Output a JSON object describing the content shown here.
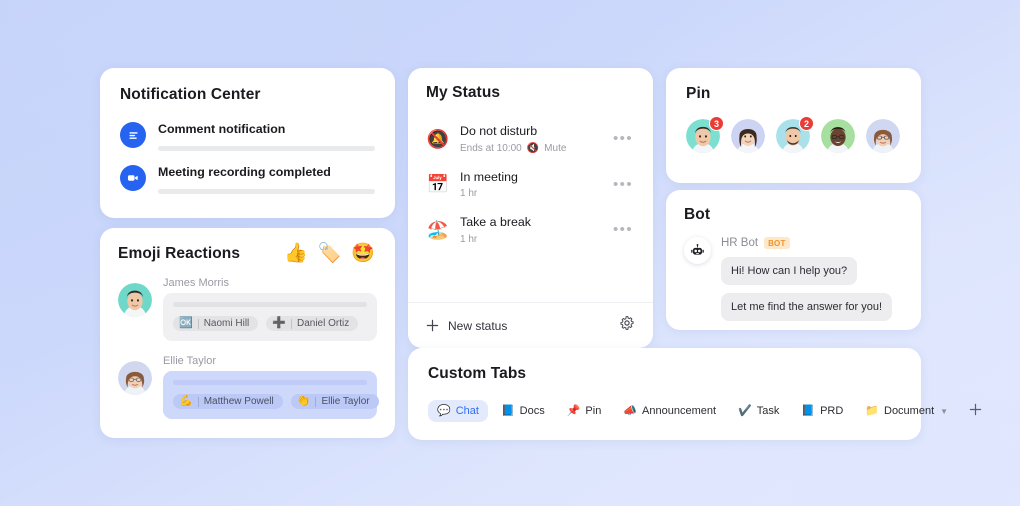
{
  "notification_center": {
    "title": "Notification Center",
    "items": [
      {
        "title": "Comment notification",
        "icon": "comment-icon"
      },
      {
        "title": "Meeting recording completed",
        "icon": "video-camera-icon"
      }
    ]
  },
  "emoji_reactions": {
    "title": "Emoji Reactions",
    "emojis": [
      "👍",
      "🏷️",
      "🤩"
    ],
    "emoji_names": [
      "thumbs-up-emoji",
      "done-badge-emoji",
      "star-struck-emoji"
    ],
    "threads": [
      {
        "name": "James Morris",
        "style": "grey",
        "chips": [
          {
            "emoji": "🆗",
            "label": "Naomi Hill"
          },
          {
            "emoji": "➕",
            "label": "Daniel Ortiz"
          }
        ]
      },
      {
        "name": "Ellie Taylor",
        "style": "blue",
        "chips": [
          {
            "emoji": "💪",
            "label": "Matthew Powell"
          },
          {
            "emoji": "👏",
            "label": "Ellie Taylor"
          }
        ]
      }
    ]
  },
  "my_status": {
    "title": "My Status",
    "items": [
      {
        "emoji": "🔕",
        "name": "Do not disturb",
        "sub": "Ends at 10:00",
        "sub_icon": "🔇",
        "sub_extra": "Mute",
        "menu": "•••"
      },
      {
        "emoji": "📅",
        "name": "In meeting",
        "sub": "1 hr",
        "sub_icon": "",
        "sub_extra": "",
        "menu": "•••"
      },
      {
        "emoji": "🏖️",
        "name": "Take a break",
        "sub": "1 hr",
        "sub_icon": "",
        "sub_extra": "",
        "menu": "•••"
      }
    ],
    "new_status_label": "New status",
    "new_status_icon": "plus-icon",
    "settings_icon": "gear-icon"
  },
  "pin": {
    "title": "Pin",
    "avatars": [
      {
        "name": "avatar-1",
        "badge": "3",
        "bg": "#7ddfd0",
        "skin": "#f0c8a8",
        "hair": "#3a2b22"
      },
      {
        "name": "avatar-2",
        "badge": "",
        "bg": "#cdd3f3",
        "skin": "#f3d3ba",
        "hair": "#3b2a20"
      },
      {
        "name": "avatar-3",
        "badge": "2",
        "bg": "#a9e1ea",
        "skin": "#f0c8a8",
        "hair": "#4a382c"
      },
      {
        "name": "avatar-4",
        "badge": "",
        "bg": "#a6dfa0",
        "skin": "#6b4430",
        "hair": "#241812"
      },
      {
        "name": "avatar-5",
        "badge": "",
        "bg": "#cfd8f0",
        "skin": "#f2cfb4",
        "hair": "#8a5a3a"
      }
    ]
  },
  "bot": {
    "title": "Bot",
    "avatar_icon": "robot-icon",
    "avatar_glyph": "🤖",
    "name": "HR Bot",
    "tag": "BOT",
    "messages": [
      "Hi! How can I help you?",
      "Let me find the answer for you!"
    ]
  },
  "custom_tabs": {
    "title": "Custom Tabs",
    "tabs": [
      {
        "label": "Chat",
        "emoji": "💬",
        "icon": "chat-icon",
        "active": true,
        "caret": false
      },
      {
        "label": "Docs",
        "emoji": "📘",
        "icon": "docs-icon",
        "active": false,
        "caret": false
      },
      {
        "label": "Pin",
        "emoji": "📌",
        "icon": "pin-icon",
        "active": false,
        "caret": false
      },
      {
        "label": "Announcement",
        "emoji": "📣",
        "icon": "announcement-icon",
        "active": false,
        "caret": false
      },
      {
        "label": "Task",
        "emoji": "✔️",
        "icon": "task-icon",
        "active": false,
        "caret": false
      },
      {
        "label": "PRD",
        "emoji": "📘",
        "icon": "prd-icon",
        "active": false,
        "caret": false
      },
      {
        "label": "Document",
        "emoji": "📁",
        "icon": "document-icon",
        "active": false,
        "caret": true
      }
    ],
    "add_label": "+",
    "add_icon": "plus-icon"
  }
}
